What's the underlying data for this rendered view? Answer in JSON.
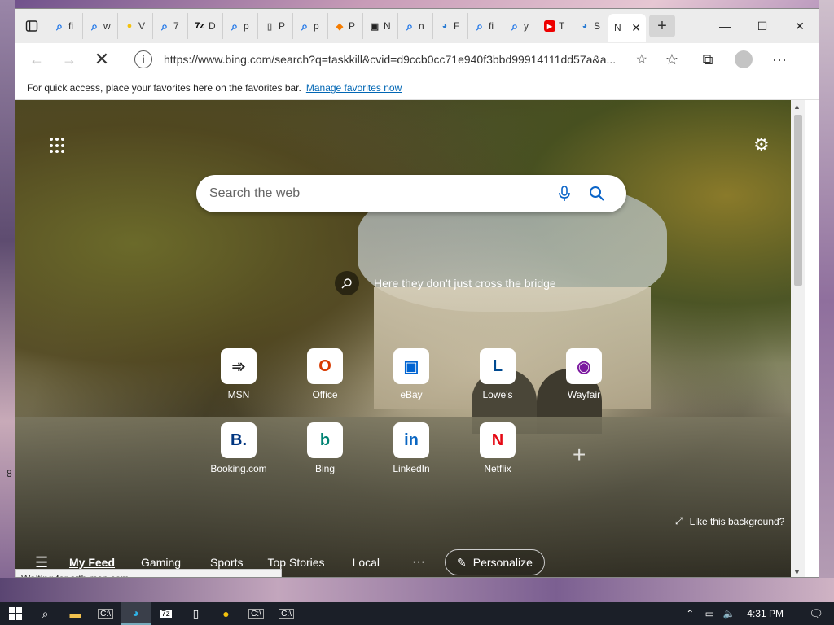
{
  "window": {
    "tabs": [
      {
        "icon": "search-icon",
        "text": "fi"
      },
      {
        "icon": "search-icon",
        "text": "w"
      },
      {
        "icon": "chrome-icon",
        "text": "V"
      },
      {
        "icon": "search-icon",
        "text": "7"
      },
      {
        "icon": "7zip-icon",
        "text": "D"
      },
      {
        "icon": "search-icon",
        "text": "p"
      },
      {
        "icon": "page-icon",
        "text": "P"
      },
      {
        "icon": "search-icon",
        "text": "p"
      },
      {
        "icon": "diamond-icon",
        "text": "P"
      },
      {
        "icon": "app-icon",
        "text": "N"
      },
      {
        "icon": "search-icon",
        "text": "n"
      },
      {
        "icon": "edge-icon",
        "text": "F"
      },
      {
        "icon": "search-icon",
        "text": "fi"
      },
      {
        "icon": "search-icon",
        "text": "y"
      },
      {
        "icon": "youtube-icon",
        "text": "T"
      },
      {
        "icon": "edge-icon",
        "text": "S"
      }
    ],
    "active_tab_text": "N",
    "new_tab": "+",
    "minimize": "—",
    "maximize": "☐",
    "close": "✕"
  },
  "address": {
    "url": "https://www.bing.com/search?q=taskkill&cvid=d9ccb0cc71e940f3bbd99914111dd57a&a...",
    "info": "i"
  },
  "favorites_bar": {
    "text": "For quick access, place your favorites here on the favorites bar.",
    "link": "Manage favorites now"
  },
  "newtab": {
    "search_placeholder": "Search the web",
    "caption": "Here they don't just cross the bridge",
    "like_bg": "Like this background?",
    "tiles_row1": [
      {
        "label": "MSN",
        "glyph": "➾",
        "color": "#222"
      },
      {
        "label": "Office",
        "glyph": "O",
        "color": "#d83b01"
      },
      {
        "label": "eBay",
        "glyph": "▣",
        "color": "#0064d2"
      },
      {
        "label": "Lowe's",
        "glyph": "L",
        "color": "#004990"
      },
      {
        "label": "Wayfair",
        "glyph": "◉",
        "color": "#7b189f"
      }
    ],
    "tiles_row2": [
      {
        "label": "Booking.com",
        "glyph": "B.",
        "color": "#003580"
      },
      {
        "label": "Bing",
        "glyph": "b",
        "color": "#008373"
      },
      {
        "label": "LinkedIn",
        "glyph": "in",
        "color": "#0a66c2"
      },
      {
        "label": "Netflix",
        "glyph": "N",
        "color": "#e50914"
      }
    ],
    "feed_items": [
      "My Feed",
      "Gaming",
      "Sports",
      "Top Stories",
      "Local"
    ],
    "more": "···",
    "personalize": "Personalize"
  },
  "status": "Waiting for srtb.msn.com...",
  "desktop_number": "8",
  "taskbar": {
    "clock": "4:31 PM"
  }
}
